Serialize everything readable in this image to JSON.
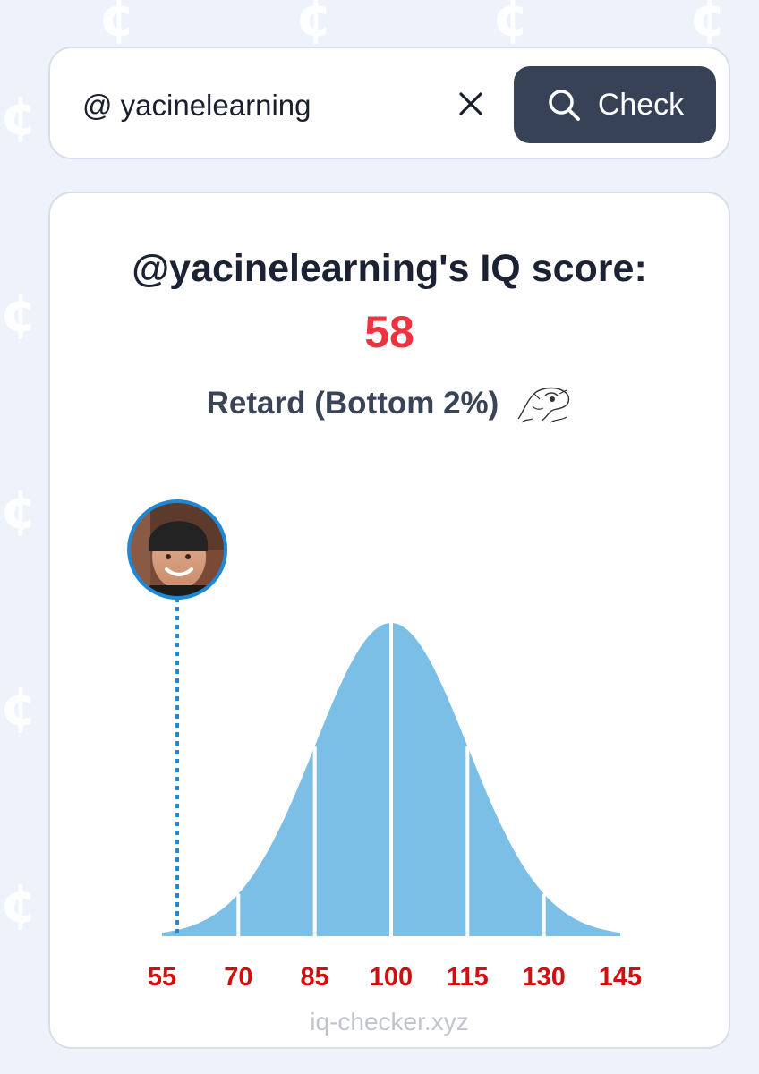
{
  "search": {
    "value": "@ yacinelearning",
    "button_label": "Check"
  },
  "result": {
    "title": "@yacinelearning's IQ score:",
    "score": "58",
    "category": "Retard (Bottom 2%)",
    "footer": "iq-checker.xyz"
  },
  "colors": {
    "page_bg": "#eef3fb",
    "button_bg": "#374256",
    "score": "#ee3340",
    "curve_fill": "#7bbfe6",
    "marker_line": "#1e88d6",
    "tick_labels": "#d20f0f"
  },
  "chart_data": {
    "type": "area",
    "distribution": "normal",
    "mean": 100,
    "sd": 15,
    "xlim": [
      55,
      145
    ],
    "x_ticks": [
      55,
      70,
      85,
      100,
      115,
      130,
      145
    ],
    "section_dividers": [
      70,
      85,
      100,
      115,
      130
    ],
    "marker": {
      "x": 58
    }
  }
}
